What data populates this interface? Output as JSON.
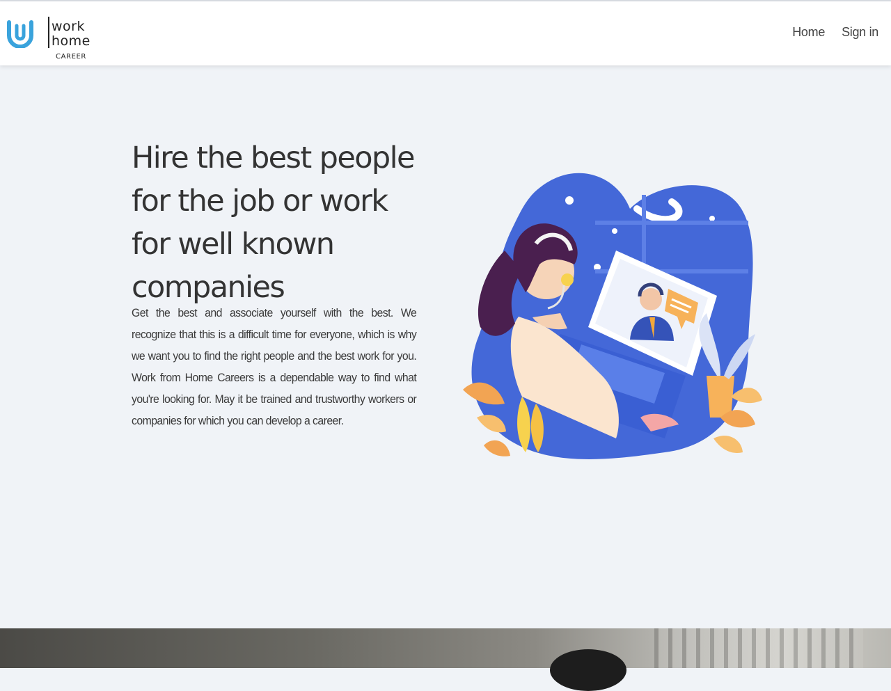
{
  "brand": {
    "logo_mark": "U",
    "line1": "work",
    "line2": "home",
    "line3": "CAREER",
    "accent": "#3aa3dc"
  },
  "nav": {
    "home": "Home",
    "sign_in": "Sign in"
  },
  "hero": {
    "title": "Hire the best people for the job or work for well known companies",
    "text": "Get the best and associate yourself with the best. We recognize that this is a difficult time for everyone, which is why we want you to find the right people and the best work for you. Work from Home Careers is a dependable way to find what you're looking for. May it be trained and trustworthy workers or companies for which you can develop a career."
  },
  "colors": {
    "page_bg": "#f0f3f7",
    "header_bg": "#ffffff",
    "text": "#333333",
    "illustration_blue": "#3f63d6"
  }
}
